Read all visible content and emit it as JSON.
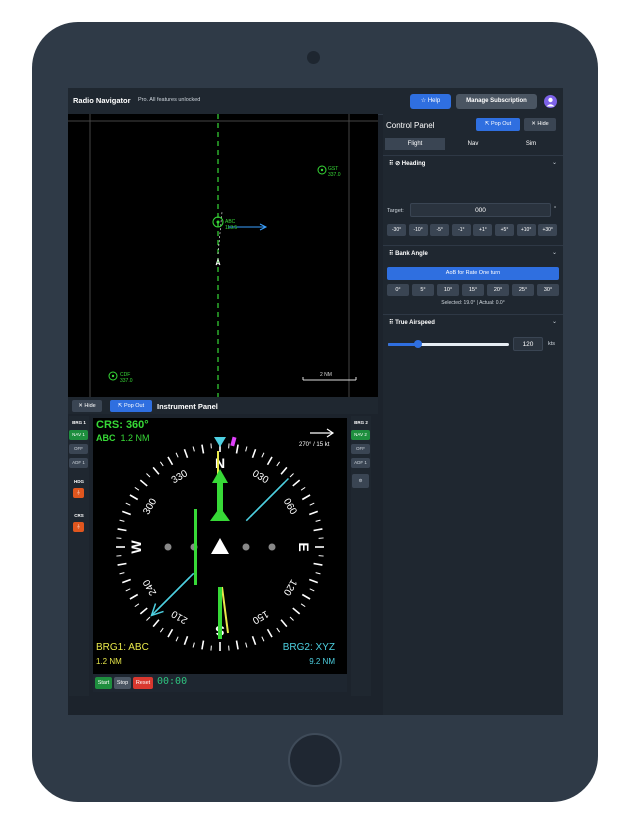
{
  "app": {
    "title": "Radio Navigator",
    "subtitle": "Pro. All features unlocked"
  },
  "header": {
    "help_label": "Help",
    "manage_label": "Manage Subscription"
  },
  "map": {
    "stations": [
      {
        "id": "GST",
        "freq": "337.0"
      },
      {
        "id": "ABC",
        "freq": "113.5"
      },
      {
        "id": "CDF",
        "freq": "337.0"
      }
    ],
    "scale_label": "2 NM"
  },
  "instrument_panel": {
    "title": "Instrument Panel",
    "hide_label": "Hide",
    "popout_label": "Pop Out",
    "left": {
      "brg1_label": "BRG 1",
      "brg1_options": [
        "NAV 1",
        "OFF",
        "ADF 1"
      ],
      "brg1_selected": "NAV 1",
      "hdg_label": "HDG",
      "crs_label": "CRS"
    },
    "right": {
      "brg2_label": "BRG 2",
      "brg2_options": [
        "NAV 2",
        "OFF",
        "ADF 1"
      ],
      "brg2_selected": "NAV 2"
    },
    "hsi": {
      "course_text": "CRS: 360°",
      "course_station": "ABC",
      "course_distance": "1.2 NM",
      "wind_text": "270° / 15 kt",
      "brg1_label": "BRG1: ABC",
      "brg1_distance": "1.2 NM",
      "brg2_label": "BRG2: XYZ",
      "brg2_distance": "9.2 NM",
      "heading_deg": 0,
      "brg1_bearing_deg": 45,
      "brg2_bearing_deg": 225,
      "cardinals": [
        "N",
        "E",
        "S",
        "W"
      ],
      "numeric_labels": [
        "3",
        "6",
        "12",
        "15",
        "21",
        "24",
        "30",
        "33"
      ],
      "digit_labels": [
        "030",
        "060",
        "120",
        "150",
        "210",
        "240",
        "300",
        "330"
      ]
    },
    "timer": {
      "start_label": "Start",
      "stop_label": "Stop",
      "reset_label": "Reset",
      "value": "00:00"
    }
  },
  "control_panel": {
    "title": "Control Panel",
    "popout_label": "Pop Out",
    "hide_label": "Hide",
    "tabs": [
      "Flight",
      "Nav",
      "Sim"
    ],
    "active_tab": "Flight",
    "heading": {
      "section_title": "Heading",
      "target_label": "Target:",
      "target_value": "000",
      "unit": "°",
      "buttons": [
        "-30°",
        "-10°",
        "-5°",
        "-1°",
        "+1°",
        "+5°",
        "+10°",
        "+30°"
      ]
    },
    "bank": {
      "section_title": "Bank Angle",
      "aob_button": "AoB for Rate One turn",
      "buttons": [
        "0°",
        "5°",
        "10°",
        "15°",
        "20°",
        "25°",
        "30°"
      ],
      "status": "Selected: 19.0° | Actual: 0.0°"
    },
    "airspeed": {
      "section_title": "True Airspeed",
      "value": "120",
      "unit": "kts",
      "slider_fraction": 0.25
    }
  },
  "colors": {
    "accent": "#2f6fe0",
    "green": "#37d937",
    "cyan": "#4dd0e1",
    "yellow": "#e8e84a",
    "magenta": "#e040fb"
  }
}
